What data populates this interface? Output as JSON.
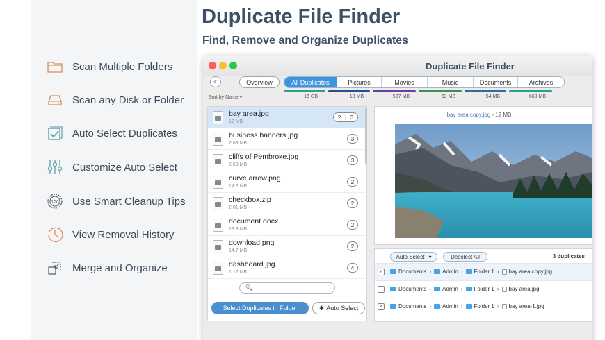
{
  "hero": {
    "title": "Duplicate File Finder",
    "subtitle": "Find, Remove and Organize Duplicates"
  },
  "features": [
    {
      "label": "Scan Multiple Folders",
      "icon": "folder-icon"
    },
    {
      "label": "Scan any Disk or Folder",
      "icon": "disk-icon"
    },
    {
      "label": "Auto Select Duplicates",
      "icon": "checkbox-icon"
    },
    {
      "label": "Customize Auto Select",
      "icon": "sliders-icon"
    },
    {
      "label": "Use Smart Cleanup Tips",
      "icon": "badge-100-icon"
    },
    {
      "label": "View Removal History",
      "icon": "clock-icon"
    },
    {
      "label": "Merge and Organize",
      "icon": "merge-icon"
    }
  ],
  "window": {
    "title": "Duplicate File Finder",
    "back_label": "<",
    "overview_label": "Overview",
    "sort_label": "Sort by Name ▾",
    "tabs": [
      {
        "label": "All Duplicates",
        "size": "16 GB",
        "color": "#2f9e8a",
        "active": true
      },
      {
        "label": "Pictures",
        "size": "13 MB",
        "color": "#2a4d8f",
        "active": false
      },
      {
        "label": "Movies",
        "size": "537 MB",
        "color": "#6b3fa0",
        "active": false
      },
      {
        "label": "Music",
        "size": "63 MB",
        "color": "#3a8f5a",
        "active": false
      },
      {
        "label": "Documents",
        "size": "54 MB",
        "color": "#2a6d9f",
        "active": false
      },
      {
        "label": "Archives",
        "size": "668 MB",
        "color": "#2a9f8f",
        "active": false
      }
    ]
  },
  "files": [
    {
      "name": "bay area.jpg",
      "size": "12 MB",
      "count": "2",
      "count2": "3",
      "selected": true
    },
    {
      "name": "business banners.jpg",
      "size": "2.63 MB",
      "count": "3"
    },
    {
      "name": "cliffs of Pembroke.jpg",
      "size": "2.63 MB",
      "count": "3"
    },
    {
      "name": "curve arrow.png",
      "size": "14.2 MB",
      "count": "2"
    },
    {
      "name": "checkbox.zip",
      "size": "2.01 MB",
      "count": "2"
    },
    {
      "name": "document.docx",
      "size": "13.9 MB",
      "count": "2"
    },
    {
      "name": "download.png",
      "size": "14.7 MB",
      "count": "2"
    },
    {
      "name": "dashboard.jpg",
      "size": "1.17 MB",
      "count": "4"
    }
  ],
  "search": {
    "placeholder": "🔍"
  },
  "actions": {
    "select_duplicates": "Select Duplicates in Folder",
    "auto_select": "Auto Select"
  },
  "preview": {
    "filename": "bay area copy.jpg",
    "size": "12 MB"
  },
  "duplicates": {
    "auto_select_label": "Auto Select",
    "deselect_label": "Deselect All",
    "count_label": "3 duplicates",
    "rows": [
      {
        "checked": "✓",
        "p1": "Documents",
        "p2": "Admin",
        "p3": "Folder 1",
        "file": "bay area copy.jpg"
      },
      {
        "checked": "",
        "p1": "Documents",
        "p2": "Admin",
        "p3": "Folder 1",
        "file": "bay area.jpg"
      },
      {
        "checked": "✓",
        "p1": "Documents",
        "p2": "Admin",
        "p3": "Folder 1",
        "file": "bay area-1.jpg"
      }
    ]
  }
}
